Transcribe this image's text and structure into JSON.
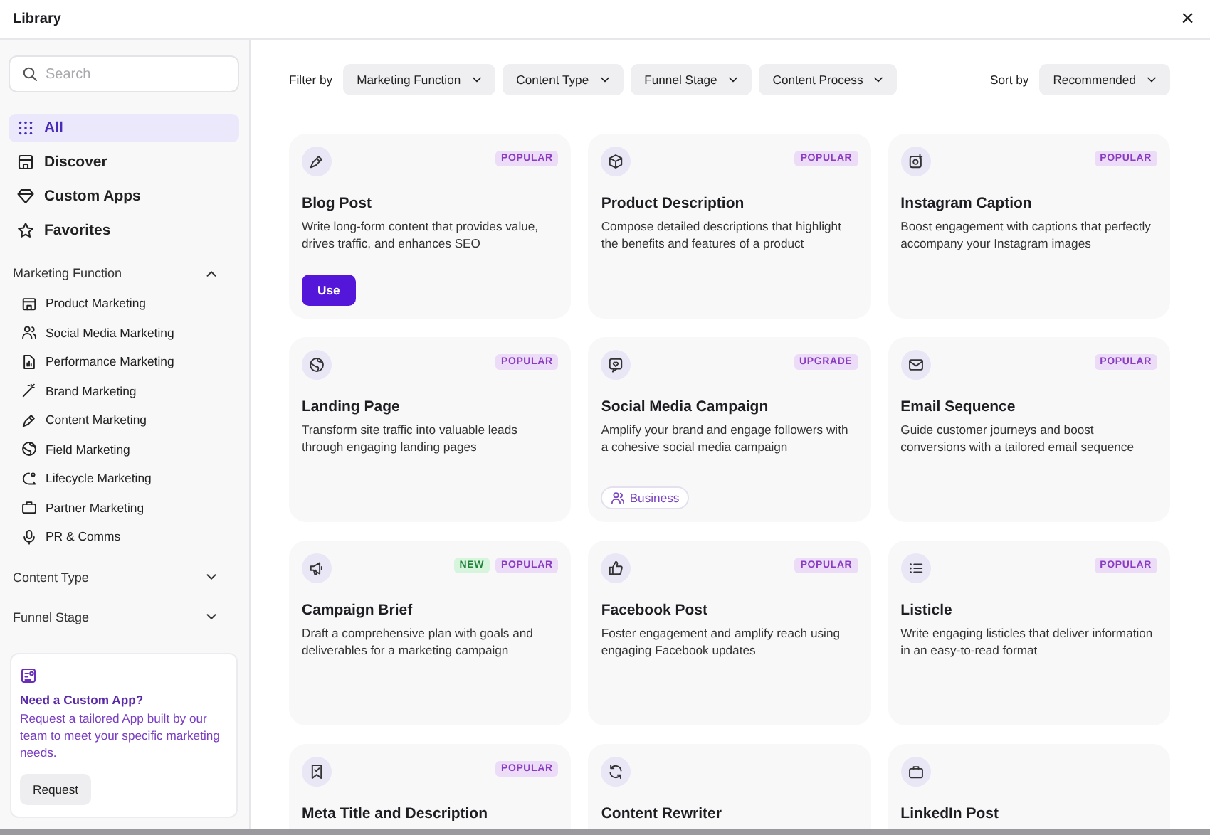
{
  "window": {
    "title": "Library",
    "close": "×"
  },
  "sidebar": {
    "search": {
      "placeholder": "Search"
    },
    "nav": [
      {
        "label": "All",
        "selected": true
      },
      {
        "label": "Discover",
        "selected": false
      },
      {
        "label": "Custom Apps",
        "selected": false
      },
      {
        "label": "Favorites",
        "selected": false
      }
    ],
    "sections": [
      {
        "title": "Marketing Function",
        "expanded": true,
        "items": [
          "Product Marketing",
          "Social Media Marketing",
          "Performance Marketing",
          "Brand Marketing",
          "Content Marketing",
          "Field Marketing",
          "Lifecycle Marketing",
          "Partner Marketing",
          "PR & Comms"
        ]
      },
      {
        "title": "Content Type",
        "expanded": false
      },
      {
        "title": "Funnel Stage",
        "expanded": false
      }
    ],
    "promo": {
      "title": "Need a Custom App?",
      "text": "Request a tailored App built by our team to meet your specific marketing needs.",
      "button": "Request"
    }
  },
  "filter_bar": {
    "label": "Filter by",
    "filters": [
      "Marketing Function",
      "Content Type",
      "Funnel Stage",
      "Content Process"
    ],
    "sort_label": "Sort by",
    "sort": "Recommended"
  },
  "cards": [
    {
      "title": "Blog Post",
      "description": "Write long-form content that provides value, drives traffic, and enhances SEO",
      "badges": [
        {
          "label": "POPULAR",
          "kind": "popular"
        }
      ],
      "button": "Use"
    },
    {
      "title": "Product Description",
      "description": "Compose detailed descriptions that highlight the benefits and features of a product",
      "badges": [
        {
          "label": "POPULAR",
          "kind": "popular"
        }
      ]
    },
    {
      "title": "Instagram Caption",
      "description": "Boost engagement with captions that perfectly accompany your Instagram images",
      "badges": [
        {
          "label": "POPULAR",
          "kind": "popular"
        }
      ]
    },
    {
      "title": "Landing Page",
      "description": "Transform site traffic into valuable leads through engaging landing pages",
      "badges": [
        {
          "label": "POPULAR",
          "kind": "popular"
        }
      ]
    },
    {
      "title": "Social Media Campaign",
      "description": "Amplify your brand and engage followers with a cohesive social media campaign",
      "badges": [
        {
          "label": "UPGRADE",
          "kind": "upgrade"
        }
      ],
      "tag": "Business"
    },
    {
      "title": "Email Sequence",
      "description": "Guide customer journeys and boost conversions with a tailored email sequence",
      "badges": [
        {
          "label": "POPULAR",
          "kind": "popular"
        }
      ]
    },
    {
      "title": "Campaign Brief",
      "description": "Draft a comprehensive plan with goals and deliverables for a marketing campaign",
      "badges": [
        {
          "label": "NEW",
          "kind": "new"
        },
        {
          "label": "POPULAR",
          "kind": "popular"
        }
      ]
    },
    {
      "title": "Facebook Post",
      "description": "Foster engagement and amplify reach using engaging Facebook updates",
      "badges": [
        {
          "label": "POPULAR",
          "kind": "popular"
        }
      ]
    },
    {
      "title": "Listicle",
      "description": "Write engaging listicles that deliver information in an easy-to-read format",
      "badges": [
        {
          "label": "POPULAR",
          "kind": "popular"
        }
      ]
    },
    {
      "title": "Meta Title and Description",
      "badges": [
        {
          "label": "POPULAR",
          "kind": "popular"
        }
      ]
    },
    {
      "title": "Content Rewriter"
    },
    {
      "title": "LinkedIn Post"
    }
  ]
}
